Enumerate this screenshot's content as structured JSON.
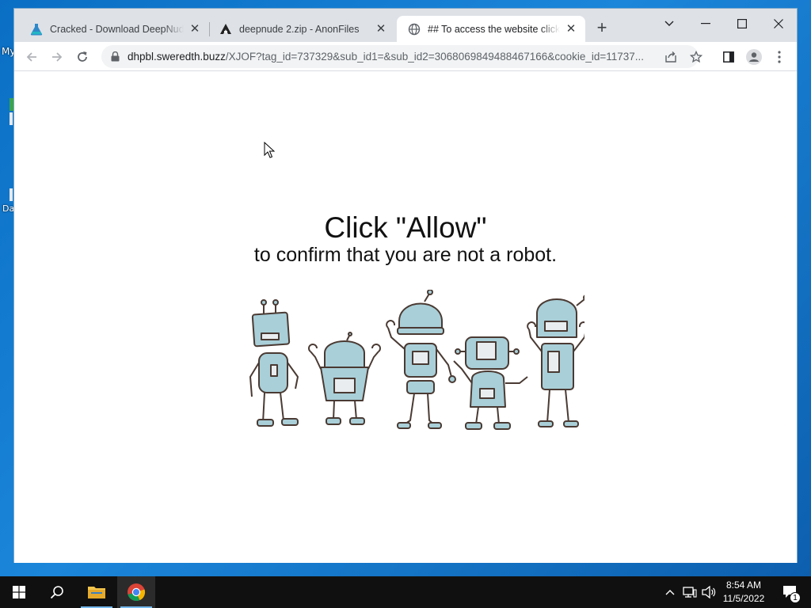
{
  "desktop": {
    "labels": [
      "My",
      "Da"
    ]
  },
  "browser": {
    "tabs": [
      {
        "title": "Cracked - Download DeepNude",
        "favicon": "flask-icon",
        "active": false
      },
      {
        "title": "deepnude 2.zip - AnonFiles",
        "favicon": "anonfiles-icon",
        "active": false
      },
      {
        "title": "## To access the website click th",
        "favicon": "globe-icon",
        "active": true
      }
    ],
    "address_bar": {
      "domain": "dhpbl.sweredth.buzz",
      "path": "/XJOF?tag_id=737329&sub_id1=&sub_id2=3068069849488467166&cookie_id=11737..."
    }
  },
  "page": {
    "headline": "Click \"Allow\"",
    "subline": "to confirm that you are not a robot."
  },
  "taskbar": {
    "time": "8:54 AM",
    "date": "11/5/2022",
    "notification_count": "1"
  },
  "colors": {
    "robot_fill": "#a9cfd8",
    "robot_outline": "#4a3a33",
    "tab_strip": "#dee1e6",
    "taskbar": "#101010"
  }
}
